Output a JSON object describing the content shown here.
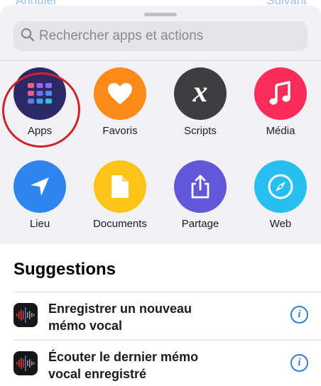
{
  "behind": {
    "left_text": "Annuler",
    "right_text": "Suivant"
  },
  "search": {
    "placeholder": "Rechercher apps et actions",
    "icon": "magnifier-icon"
  },
  "categories": [
    {
      "label": "Apps",
      "icon": "app-grid-icon",
      "color": "#2b2a66"
    },
    {
      "label": "Favoris",
      "icon": "heart-icon",
      "color": "#fb8a1a"
    },
    {
      "label": "Scripts",
      "icon": "x-variable-icon",
      "color": "#3e3e40"
    },
    {
      "label": "Média",
      "icon": "music-note-icon",
      "color": "#fa2d5a"
    },
    {
      "label": "Lieu",
      "icon": "location-arrow-icon",
      "color": "#2f84f0"
    },
    {
      "label": "Documents",
      "icon": "document-icon",
      "color": "#fdc318"
    },
    {
      "label": "Partage",
      "icon": "share-icon",
      "color": "#6257d8"
    },
    {
      "label": "Web",
      "icon": "compass-icon",
      "color": "#27bff0"
    }
  ],
  "suggestions": {
    "title": "Suggestions",
    "items": [
      {
        "line1": "Enregistrer un nouveau",
        "line2": "mémo vocal",
        "app_icon": "voice-memos-icon",
        "info_icon": "info-icon",
        "info_glyph": "i"
      },
      {
        "line1": "Écouter le dernier mémo",
        "line2": "vocal enregistré",
        "app_icon": "voice-memos-icon",
        "info_icon": "info-icon",
        "info_glyph": "i"
      }
    ]
  },
  "colors": {
    "accent": "#2f7de1",
    "highlight": "#d0222a",
    "sheet": "#f2f1f6"
  }
}
